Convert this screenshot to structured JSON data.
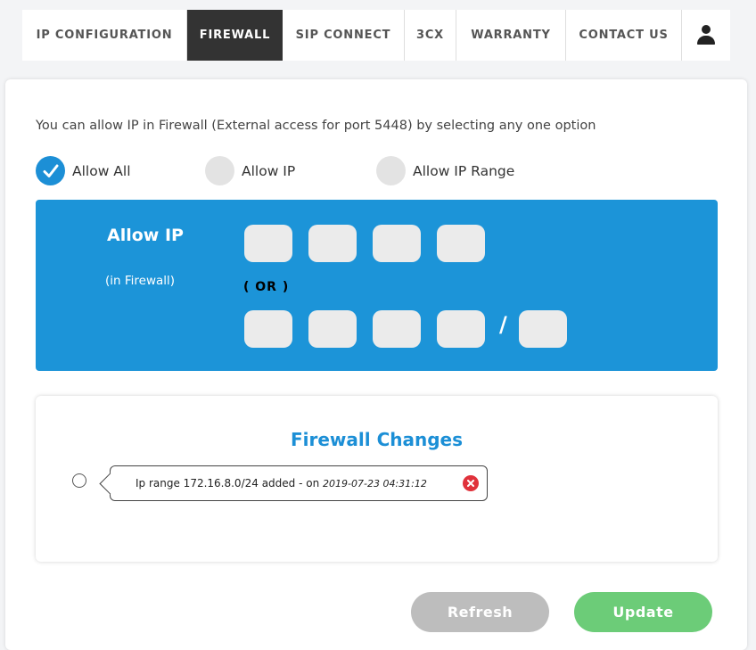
{
  "nav": {
    "tabs": [
      {
        "label": "IP CONFIGURATION"
      },
      {
        "label": "FIREWALL"
      },
      {
        "label": "SIP CONNECT"
      },
      {
        "label": "3CX"
      },
      {
        "label": "WARRANTY"
      },
      {
        "label": "CONTACT US"
      }
    ],
    "active_tab": "FIREWALL",
    "user_icon": "user-icon"
  },
  "intro_text": "You can allow IP in Firewall (External access for port 5448) by selecting any one option",
  "options": [
    {
      "label": "Allow All",
      "checked": true
    },
    {
      "label": "Allow IP",
      "checked": false
    },
    {
      "label": "Allow IP Range",
      "checked": false
    }
  ],
  "allow_panel": {
    "title": "Allow IP",
    "subtitle": "(in Firewall)",
    "or_label": "( OR )",
    "slash": "/"
  },
  "changes": {
    "title": "Firewall Changes",
    "entries": [
      {
        "message": "Ip range 172.16.8.0/24 added - on",
        "timestamp": "2019-07-23 04:31:12"
      }
    ]
  },
  "buttons": {
    "refresh": "Refresh",
    "update": "Update"
  },
  "colors": {
    "accent_blue": "#1c94d8",
    "nav_active": "#333333",
    "refresh_button": "#bdbdbd",
    "update_button": "#6ccc78",
    "delete_icon": "#e0323b"
  }
}
